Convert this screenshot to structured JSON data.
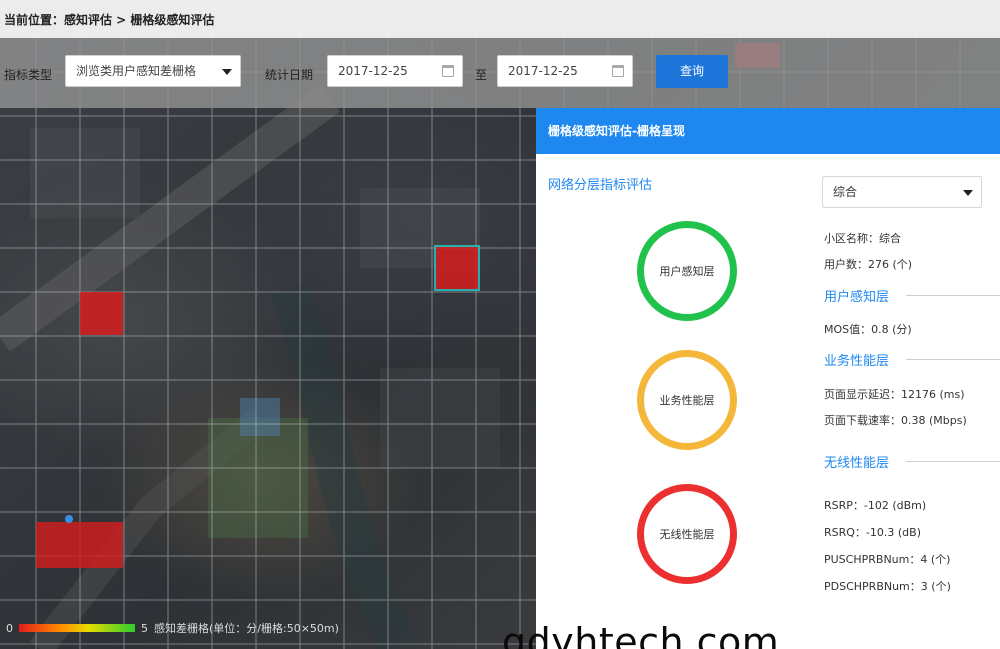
{
  "breadcrumb": {
    "label": "当前位置：感知评估 > 栅格级感知评估"
  },
  "toolbar": {
    "type_label": "指标类型",
    "type_value": "浏览类用户感知差栅格",
    "date_label": "统计日期",
    "start_date": "2017-12-25",
    "to_label": "至",
    "end_date": "2017-12-25",
    "query_label": "查询"
  },
  "panel": {
    "header": "栅格级感知评估-栅格呈现",
    "subtitle": "网络分层指标评估",
    "select_value": "综合",
    "rings": {
      "user": "用户感知层",
      "service": "业务性能层",
      "wireless": "无线性能层"
    },
    "cell_name": "小区名称：综合",
    "user_count": "用户数：276 (个)",
    "sections": {
      "user": {
        "title": "用户感知层",
        "lines": [
          "MOS值：0.8 (分)"
        ]
      },
      "service": {
        "title": "业务性能层",
        "lines": [
          "页面显示延迟：12176 (ms)",
          "页面下载速率：0.38 (Mbps)"
        ]
      },
      "wireless": {
        "title": "无线性能层",
        "lines": [
          "RSRP：-102 (dBm)",
          "RSRQ：-10.3 (dB)",
          "PUSCHPRBNum：4 (个)",
          "PDSCHPRBNum：3 (个)"
        ]
      }
    }
  },
  "map": {
    "legend_min": "0",
    "legend_max": "5",
    "legend_text": "感知差栅格(单位：分/栅格:50×50m)",
    "highlight_color": "#e01e1e"
  },
  "watermark": "gdyhtech.com",
  "colors": {
    "accent": "#1e88f0",
    "query_button": "#1d74d9",
    "ring_user": "#21c24b",
    "ring_service": "#f4b73a",
    "ring_wireless": "#ec2f2f"
  }
}
